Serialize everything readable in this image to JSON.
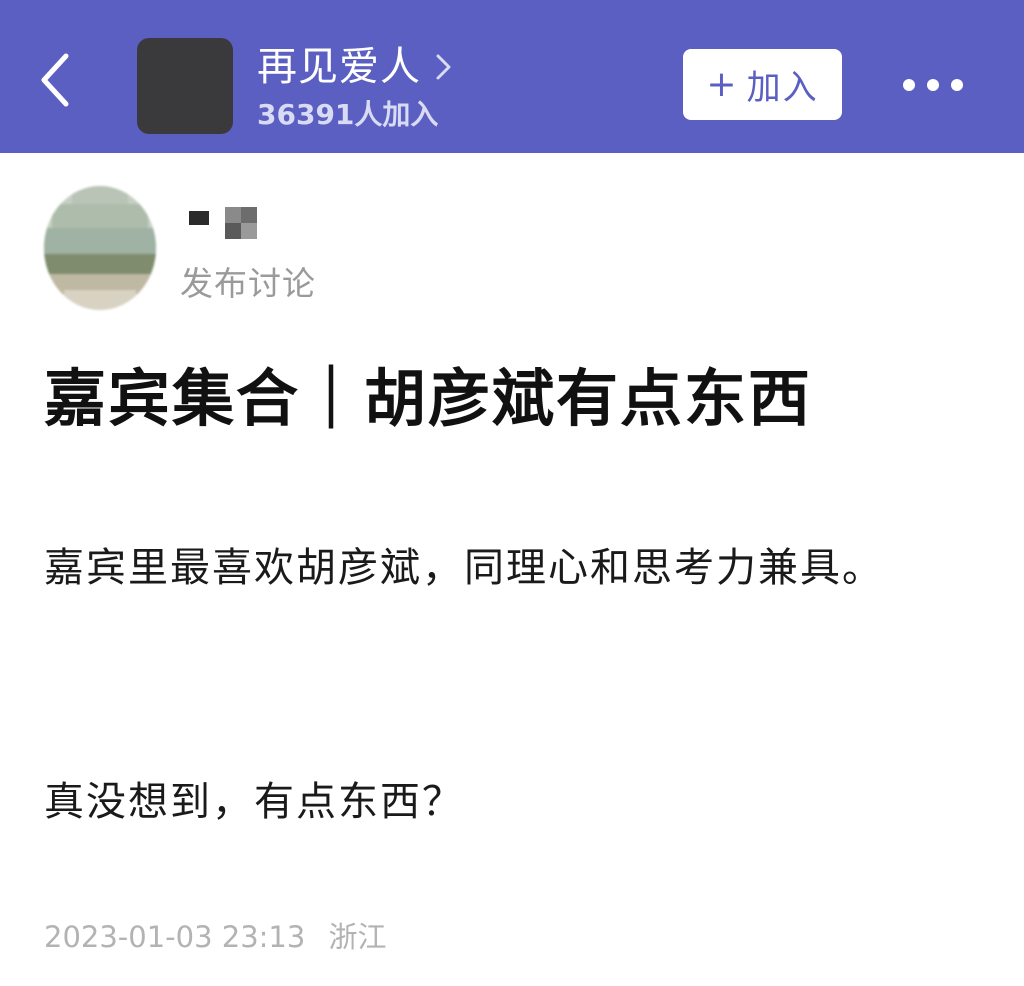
{
  "header": {
    "back_icon": "chevron-left-icon",
    "group_name": "再见爱人",
    "member_count": "36391人加入",
    "join_button": {
      "plus": "+",
      "label": "加入"
    },
    "more_icon": "more-dots-icon"
  },
  "post": {
    "type_label": "发布讨论",
    "title": "嘉宾集合｜胡彦斌有点东西",
    "body_paragraph_1": "嘉宾里最喜欢胡彦斌，同理心和思考力兼具。",
    "body_paragraph_2": "真没想到，有点东西？",
    "timestamp": "2023-01-03 23:13",
    "location": "浙江"
  },
  "colors": {
    "header_bg": "#5b5fc1",
    "accent": "#5b5fc1",
    "meta_text": "#b3b3b3"
  }
}
